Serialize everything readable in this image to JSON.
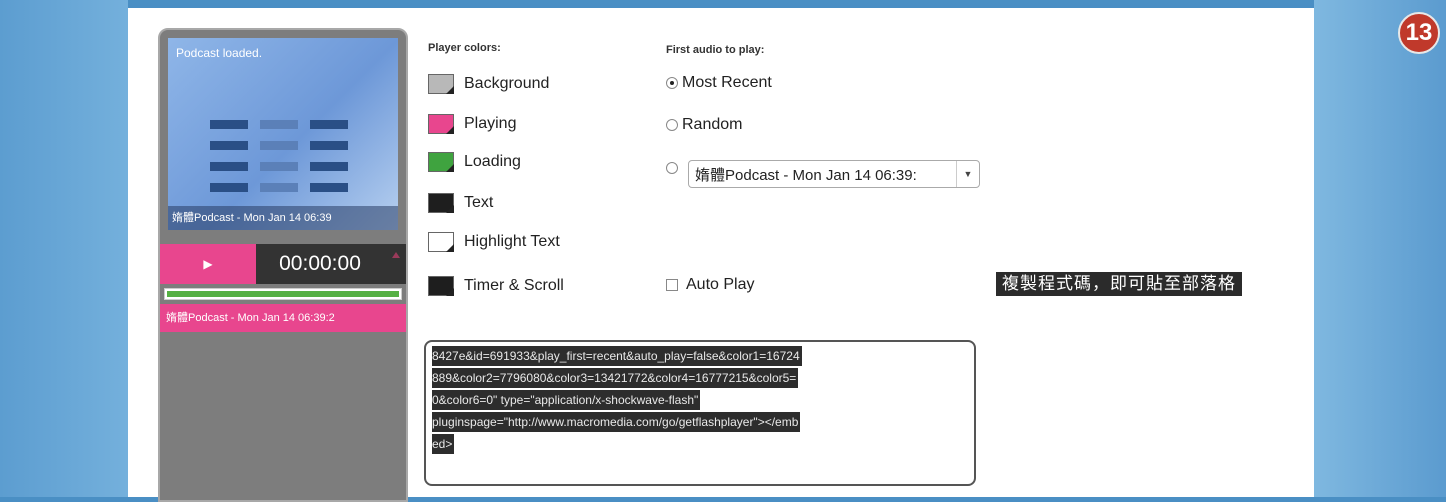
{
  "step_badge": "13",
  "player": {
    "status": "Podcast loaded.",
    "screen_title": "媠體Podcast - Mon Jan 14 06:39",
    "play_glyph": "▶",
    "time": "00:00:00",
    "bar_title": "媠體Podcast - Mon Jan 14 06:39:2",
    "progress": 1.0
  },
  "player_colors": {
    "label": "Player colors:",
    "items": [
      {
        "label": "Background",
        "color": "#b8b8b8"
      },
      {
        "label": "Playing",
        "color": "#e8468e"
      },
      {
        "label": "Loading",
        "color": "#3fa33f"
      },
      {
        "label": "Text",
        "color": "#1e1e1e"
      },
      {
        "label": "Highlight Text",
        "color": "#ffffff"
      },
      {
        "label": "Timer & Scroll",
        "color": "#1e1e1e"
      }
    ]
  },
  "first_audio": {
    "label": "First audio to play:",
    "options": [
      {
        "label": "Most Recent",
        "checked": true
      },
      {
        "label": "Random",
        "checked": false
      },
      {
        "label": "",
        "checked": false
      }
    ],
    "select_value": "媠體Podcast - Mon Jan 14 06:39:"
  },
  "auto_play_label": "Auto Play",
  "caption": "複製程式碼，即可貼至部落格",
  "embed_code": [
    "8427e&id=691933&play_first=recent&auto_play=false&color1=16724",
    "889&color2=7796080&color3=13421772&color4=16777215&color5=",
    "0&color6=0\" type=\"application/x-shockwave-flash\"",
    "pluginspage=\"http://www.macromedia.com/go/getflashplayer\"></emb",
    "ed>"
  ]
}
